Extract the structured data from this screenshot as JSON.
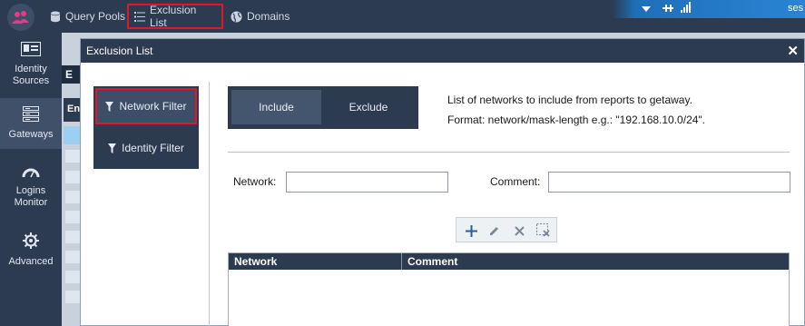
{
  "topbar": {
    "items": [
      {
        "label": "Query Pools",
        "icon": "database-icon"
      },
      {
        "label": "Exclusion List",
        "icon": "list-icon"
      },
      {
        "label": "Domains",
        "icon": "globe-icon"
      }
    ],
    "user_fragment": "ses"
  },
  "leftnav": {
    "items": [
      {
        "label": "Identity\nSources",
        "icon": "id-card-icon"
      },
      {
        "label": "Gateways",
        "icon": "server-stack-icon",
        "active": true
      },
      {
        "label": "Logins\nMonitor",
        "icon": "gauge-icon"
      },
      {
        "label": "Advanced",
        "icon": "gear-icon"
      }
    ]
  },
  "backdrop": {
    "header_fragment": "En",
    "button_fragment": "E"
  },
  "dialog": {
    "title": "Exclusion List",
    "filters": [
      {
        "label": "Network Filter",
        "active": true
      },
      {
        "label": "Identity Filter"
      }
    ],
    "toggle": {
      "include": "Include",
      "exclude": "Exclude",
      "selected": "Include"
    },
    "description": {
      "line1": "List of networks to include from reports to getaway.",
      "line2": "Format: network/mask-length  e.g.: \"192.168.10.0/24\"."
    },
    "form": {
      "network_label": "Network:",
      "network_value": "",
      "comment_label": "Comment:",
      "comment_value": ""
    },
    "toolbar": [
      "add-icon",
      "edit-icon",
      "delete-icon",
      "clear-selection-icon"
    ],
    "table": {
      "columns": [
        "Network",
        "Comment"
      ],
      "rows": []
    }
  },
  "colors": {
    "nav_bg": "#2d3b51",
    "highlight_border": "#e0162b",
    "active_nav": "#3f5068"
  }
}
